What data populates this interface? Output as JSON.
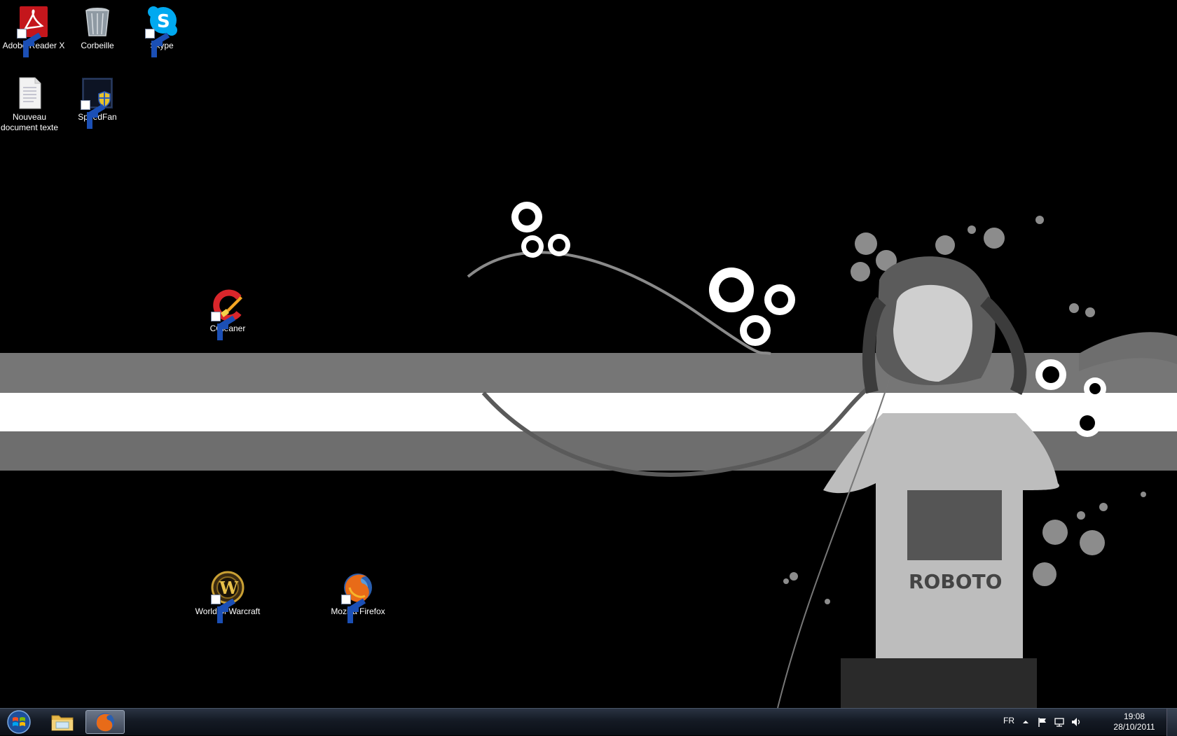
{
  "desktop": {
    "icons": [
      {
        "label": "Adobe Reader X",
        "icon": "adobe-reader-icon"
      },
      {
        "label": "Corbeille",
        "icon": "recycle-bin-icon"
      },
      {
        "label": "Skype",
        "icon": "skype-icon"
      },
      {
        "label": "Nouveau document texte",
        "icon": "text-document-icon"
      },
      {
        "label": "SpeedFan",
        "icon": "speedfan-icon"
      },
      {
        "label": "CCleaner",
        "icon": "ccleaner-icon"
      },
      {
        "label": "World of Warcraft",
        "icon": "world-of-warcraft-icon"
      },
      {
        "label": "Mozilla Firefox",
        "icon": "firefox-icon"
      }
    ],
    "wallpaper": {
      "text": "ROBOTO"
    }
  },
  "taskbar": {
    "start": {
      "icon": "windows-logo-icon"
    },
    "pinned": [
      {
        "name": "Windows Explorer",
        "icon": "folder-explorer-icon",
        "active": false
      },
      {
        "name": "Mozilla Firefox",
        "icon": "firefox-icon",
        "active": true
      }
    ],
    "tray": {
      "language": "FR",
      "icons": [
        "show-hidden-icons-arrow",
        "action-center-flag-icon",
        "network-icon",
        "volume-icon"
      ],
      "time": "19:08",
      "date": "28/10/2011"
    }
  },
  "colors": {
    "background": "#000000",
    "band_gray": "#7a7a7a",
    "band_white": "#ffffff",
    "taskbar": "#141a24"
  }
}
